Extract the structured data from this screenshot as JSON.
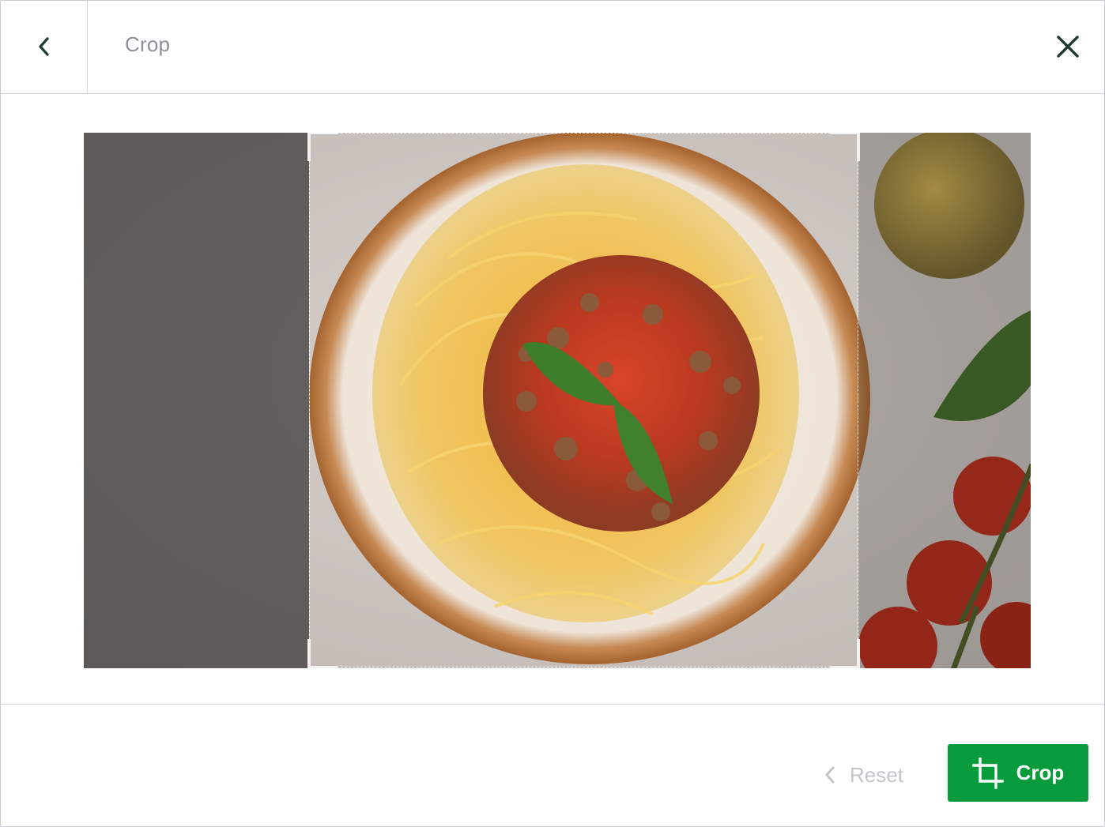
{
  "header": {
    "title": "Crop",
    "back_icon": "chevron-left-icon",
    "close_icon": "close-icon"
  },
  "image": {
    "subject": "spaghetti-bolognese-photo"
  },
  "footer": {
    "reset_label": "Reset",
    "reset_icon": "chevron-left-icon",
    "crop_label": "Crop",
    "crop_icon": "crop-icon"
  },
  "colors": {
    "primary": "#089b3c",
    "dark_icon": "#1f3a2e",
    "title_text": "#8c9196",
    "disabled_text": "#c3c6c9"
  }
}
